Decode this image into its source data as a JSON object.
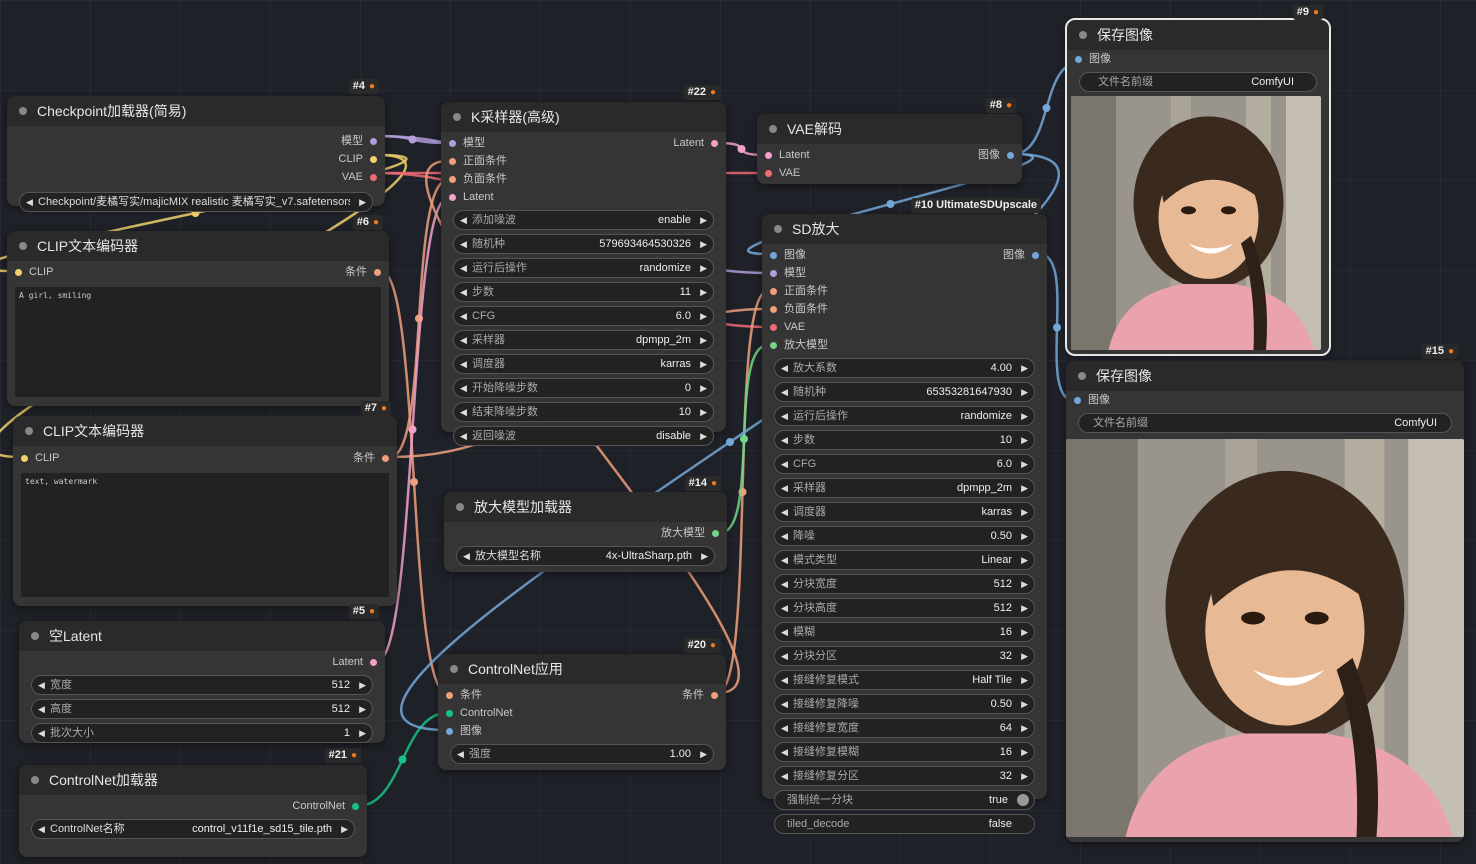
{
  "colors": {
    "model": "#b39ddb",
    "clip": "#f2d16b",
    "vae": "#ef6b75",
    "cond": "#ef9f7b",
    "latent": "#f2a2c9",
    "image": "#74a7d9",
    "upscale_model": "#72d685",
    "controlnet": "#18c18a"
  },
  "nodes": {
    "n4": {
      "id": "#4",
      "title": "Checkpoint加载器(简易)",
      "outputs": [
        "模型",
        "CLIP",
        "VAE"
      ],
      "ckpt_value": "Checkpoint/麦橘写实/majicMIX realistic 麦橘写实_v7.safetensors"
    },
    "n6": {
      "id": "#6",
      "title": "CLIP文本编码器",
      "input": "CLIP",
      "output": "条件",
      "text": "A girl, smiling"
    },
    "n7": {
      "id": "#7",
      "title": "CLIP文本编码器",
      "input": "CLIP",
      "output": "条件",
      "text": "text, watermark"
    },
    "n5": {
      "id": "#5",
      "title": "空Latent",
      "output": "Latent",
      "widgets": [
        {
          "label": "宽度",
          "value": "512"
        },
        {
          "label": "高度",
          "value": "512"
        },
        {
          "label": "批次大小",
          "value": "1"
        }
      ]
    },
    "n21": {
      "id": "#21",
      "title": "ControlNet加载器",
      "output": "ControlNet",
      "widget": {
        "label": "ControlNet名称",
        "value": "control_v11f1e_sd15_tile.pth"
      }
    },
    "n22": {
      "id": "#22",
      "title": "K采样器(高级)",
      "inputs": [
        "模型",
        "正面条件",
        "负面条件",
        "Latent"
      ],
      "output": "Latent",
      "widgets": [
        {
          "label": "添加噪波",
          "value": "enable"
        },
        {
          "label": "随机种",
          "value": "579693464530326"
        },
        {
          "label": "运行后操作",
          "value": "randomize"
        },
        {
          "label": "步数",
          "value": "11"
        },
        {
          "label": "CFG",
          "value": "6.0"
        },
        {
          "label": "采样器",
          "value": "dpmpp_2m"
        },
        {
          "label": "调度器",
          "value": "karras"
        },
        {
          "label": "开始降噪步数",
          "value": "0"
        },
        {
          "label": "结束降噪步数",
          "value": "10"
        },
        {
          "label": "返回噪波",
          "value": "disable"
        }
      ]
    },
    "n14": {
      "id": "#14",
      "title": "放大模型加载器",
      "output": "放大模型",
      "widget": {
        "label": "放大模型名称",
        "value": "4x-UltraSharp.pth"
      }
    },
    "n20": {
      "id": "#20",
      "title": "ControlNet应用",
      "inputs": [
        "条件",
        "ControlNet",
        "图像"
      ],
      "output": "条件",
      "widget": {
        "label": "强度",
        "value": "1.00"
      }
    },
    "n8": {
      "id": "#8",
      "title": "VAE解码",
      "inputs": [
        "Latent",
        "VAE"
      ],
      "output": "图像"
    },
    "n10": {
      "id": "#10 UltimateSDUpscale",
      "title": "SD放大",
      "inputs": [
        "图像",
        "模型",
        "正面条件",
        "负面条件",
        "VAE",
        "放大模型"
      ],
      "output": "图像",
      "widgets": [
        {
          "label": "放大系数",
          "value": "4.00"
        },
        {
          "label": "随机种",
          "value": "65353281647930"
        },
        {
          "label": "运行后操作",
          "value": "randomize"
        },
        {
          "label": "步数",
          "value": "10"
        },
        {
          "label": "CFG",
          "value": "6.0"
        },
        {
          "label": "采样器",
          "value": "dpmpp_2m"
        },
        {
          "label": "调度器",
          "value": "karras"
        },
        {
          "label": "降噪",
          "value": "0.50"
        },
        {
          "label": "模式类型",
          "value": "Linear"
        },
        {
          "label": "分块宽度",
          "value": "512"
        },
        {
          "label": "分块高度",
          "value": "512"
        },
        {
          "label": "模糊",
          "value": "16"
        },
        {
          "label": "分块分区",
          "value": "32"
        },
        {
          "label": "接缝修复模式",
          "value": "Half Tile"
        },
        {
          "label": "接缝修复降噪",
          "value": "0.50"
        },
        {
          "label": "接缝修复宽度",
          "value": "64"
        },
        {
          "label": "接缝修复模糊",
          "value": "16"
        },
        {
          "label": "接缝修复分区",
          "value": "32"
        }
      ],
      "toggles": [
        {
          "label": "强制统一分块",
          "value": "true"
        },
        {
          "label": "tiled_decode",
          "value": "false"
        }
      ]
    },
    "n9": {
      "id": "#9",
      "title": "保存图像",
      "input": "图像",
      "widget": {
        "label": "文件名前缀",
        "value": "ComfyUI"
      }
    },
    "n15": {
      "id": "#15",
      "title": "保存图像",
      "input": "图像",
      "widget": {
        "label": "文件名前缀",
        "value": "ComfyUI"
      }
    }
  }
}
